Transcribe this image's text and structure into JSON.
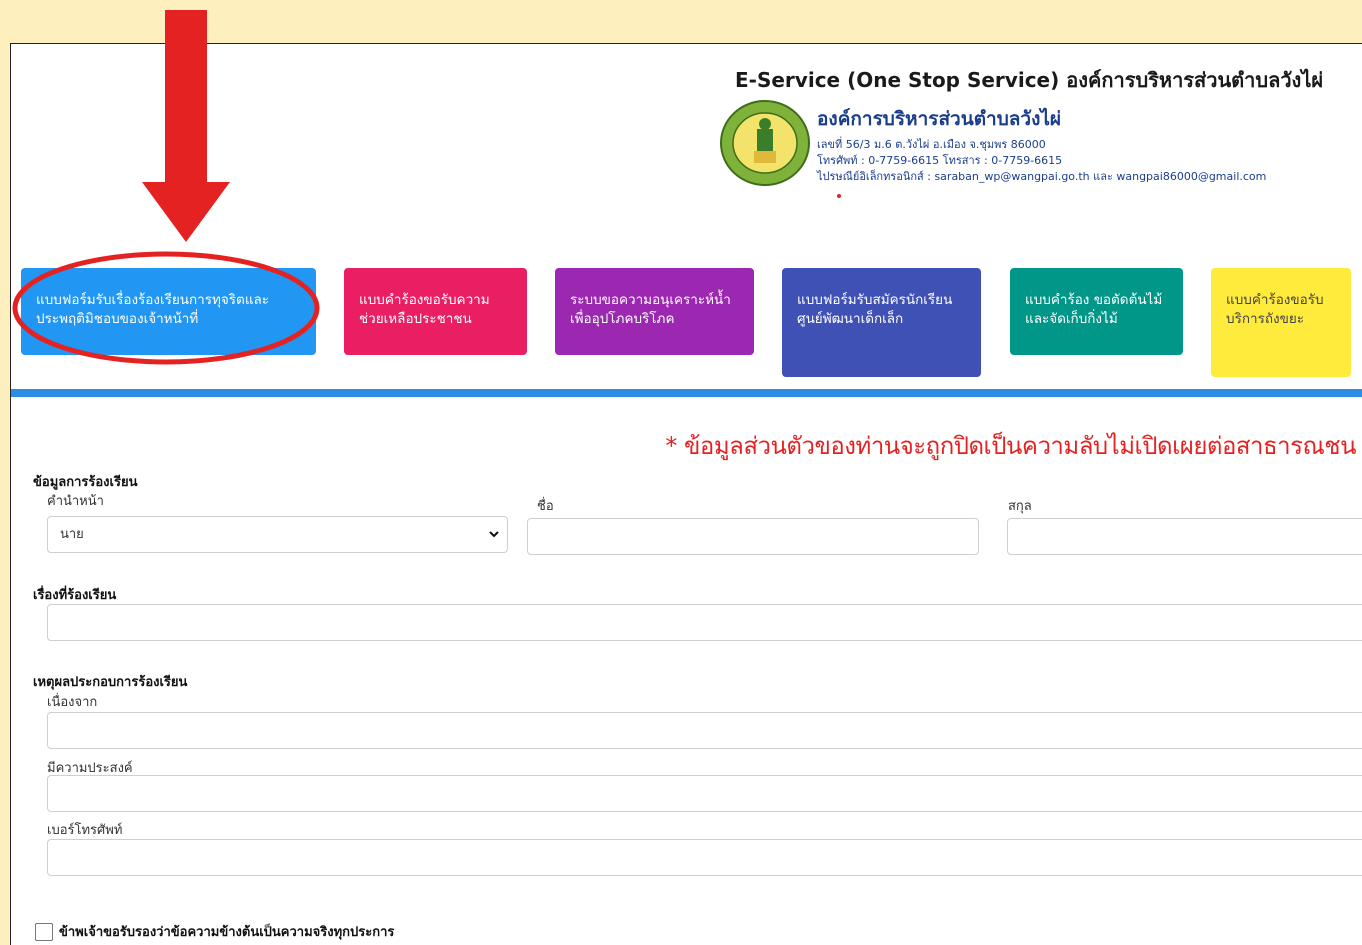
{
  "header": {
    "title": "E-Service (One Stop Service) องค์การบริหารส่วนตำบลวังไผ่",
    "org_name": "องค์การบริหารส่วนตำบลวังไผ่",
    "address": "เลขที่ 56/3 ม.6 ต.วังไผ่ อ.เมือง จ.ชุมพร 86000",
    "phone": "โทรศัพท์ : 0-7759-6615 โทรสาร : 0-7759-6615",
    "email": "ไปรษณีย์อิเล็กทรอนิกส์ : saraban_wp@wangpai.go.th และ wangpai86000@gmail.com",
    "logo_icon": "seal-logo-icon"
  },
  "services": [
    {
      "label": "แบบฟอร์มรับเรื่องร้องเรียนการทุจริตและประพฤติมิชอบของเจ้าหน้าที่",
      "color": "#2196f3"
    },
    {
      "label": "แบบคำร้องขอรับความช่วยเหลือประชาชน",
      "color": "#e91e63"
    },
    {
      "label": "ระบบขอความอนุเคราะห์น้ำเพื่ออุปโภคบริโภค",
      "color": "#9c27b0"
    },
    {
      "label": "แบบฟอร์มรับสมัครนักเรียนศูนย์พัฒนาเด็กเล็ก",
      "color": "#3f51b5"
    },
    {
      "label": "แบบคำร้อง ขอตัดต้นไม้และจัดเก็บกิ่งไม้",
      "color": "#009688"
    },
    {
      "label": "แบบคำร้องขอรับบริการถังขยะ",
      "color": "#ffeb3b"
    }
  ],
  "annotation": {
    "arrow_icon": "red-arrow-down-icon",
    "highlight_color": "#e52222"
  },
  "privacy_notice": "* ข้อมูลส่วนตัวของท่านจะถูกปิดเป็นความลับไม่เปิดเผยต่อสาธารณชน",
  "form": {
    "complainant_section": "ข้อมูลการร้องเรียน",
    "prefix_label": "คำนำหน้า",
    "prefix_value": "นาย",
    "firstname_label": "ชื่อ",
    "lastname_label": "สกุล",
    "subject_section": "เรื่องที่ร้องเรียน",
    "reason_section": "เหตุผลประกอบการร้องเรียน",
    "because_label": "เนื่องจาก",
    "purpose_label": "มีความประสงค์",
    "phone_label": "เบอร์โทรศัพท์",
    "certify_label": "ข้าพเจ้าขอรับรองว่าข้อความข้างต้นเป็นความจริงทุกประการ"
  }
}
